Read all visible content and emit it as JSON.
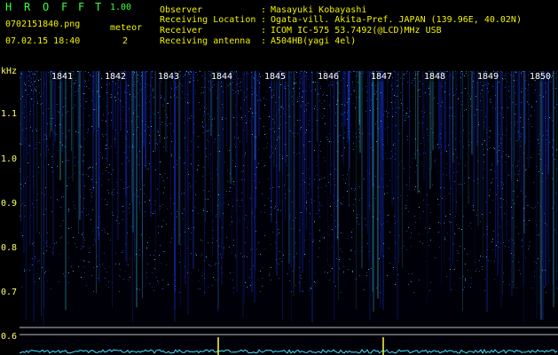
{
  "app": {
    "title_letters": [
      "H",
      "R",
      "O",
      "F",
      "F",
      "T"
    ],
    "version": "1.00",
    "filename": "0702151840.png",
    "datetime": "07.02.15 18:40",
    "meteor_label": "meteor",
    "meteor_count": "2"
  },
  "info": {
    "rows": [
      {
        "label": "Observer",
        "sep": ":",
        "value": "Masayuki Kobayashi"
      },
      {
        "label": "Receiving Location",
        "sep": ":",
        "value": "Ogata-vill. Akita-Pref. JAPAN (139.96E, 40.02N)"
      },
      {
        "label": "Receiver",
        "sep": ":",
        "value": "ICOM IC-575 53.7492(@LCD)MHz USB"
      },
      {
        "label": "Receiving antenna",
        "sep": ":",
        "value": "A504HB(yagi 4el)"
      }
    ]
  },
  "axis": {
    "unit": "kHz",
    "ticks": [
      "1.1",
      "1.0",
      "0.9",
      "0.8",
      "0.7",
      "0.6"
    ]
  },
  "minutes": [
    "1841",
    "1842",
    "1843",
    "1844",
    "1845",
    "1846",
    "1847",
    "1848",
    "1849",
    "1850"
  ],
  "colors": {
    "background": "#000000",
    "label_yellow": "#f2f200",
    "title_green": "#3cff3c",
    "signal_blue": "#1a3cff",
    "signal_cyan": "#40e0ff",
    "meteor_yellow": "#ffff40"
  }
}
